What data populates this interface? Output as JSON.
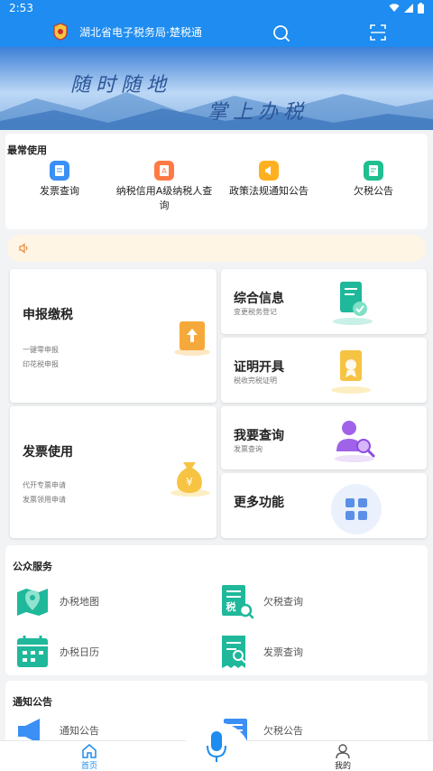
{
  "status": {
    "time": "2:53"
  },
  "header": {
    "title": "湖北省电子税务局·楚税通"
  },
  "banner": {
    "slogan_left": "随时随地",
    "slogan_right": "掌上办税"
  },
  "common": {
    "title": "最常使用",
    "items": [
      {
        "label": "发票查询",
        "color": "#3b8ff5"
      },
      {
        "label": "纳税信用A级纳税人查询",
        "color": "#ff7a45"
      },
      {
        "label": "政策法规通知公告",
        "color": "#ffb020"
      },
      {
        "label": "欠税公告",
        "color": "#1fbf8f"
      }
    ]
  },
  "tiles": {
    "declare": {
      "title": "申报缴税",
      "lines": [
        "一键零申报",
        "印花税申报"
      ]
    },
    "invoice": {
      "title": "发票使用",
      "lines": [
        "代开专票申请",
        "发票领用申请"
      ]
    },
    "info": {
      "title": "综合信息",
      "sub": "变更税务登记"
    },
    "cert": {
      "title": "证明开具",
      "sub": "税收完税证明"
    },
    "query": {
      "title": "我要查询",
      "sub": "发票查询"
    },
    "more": {
      "title": "更多功能"
    }
  },
  "public": {
    "title": "公众服务",
    "items": [
      {
        "label": "办税地图",
        "icon": "map-pin-icon"
      },
      {
        "label": "欠税查询",
        "icon": "tax-doc-search-icon"
      },
      {
        "label": "办税日历",
        "icon": "calendar-icon"
      },
      {
        "label": "发票查询",
        "icon": "invoice-search-icon"
      }
    ]
  },
  "notice": {
    "title": "通知公告",
    "items": [
      {
        "label": "通知公告"
      },
      {
        "label": "欠税公告"
      }
    ]
  },
  "tabbar": {
    "home": "首页",
    "mine": "我的"
  },
  "colors": {
    "primary": "#1e8cf0",
    "teal": "#1fb89a",
    "gold": "#f6b93b"
  }
}
